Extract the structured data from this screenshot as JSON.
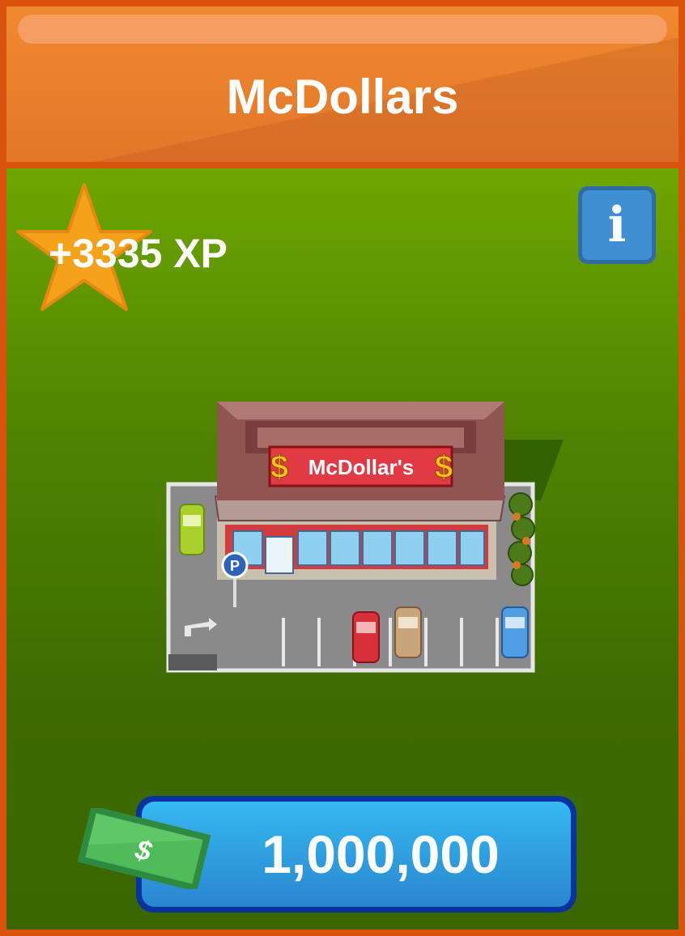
{
  "header": {
    "title": "McDollars"
  },
  "reward": {
    "xp_label": "+3335 XP",
    "icon": "star-icon"
  },
  "info_button": {
    "glyph": "i",
    "icon": "info-icon"
  },
  "building": {
    "sign_text": "McDollar's",
    "icon": "restaurant-building-image"
  },
  "purchase": {
    "price": "1,000,000",
    "cash_symbol": "$",
    "icon": "cash-bill-icon"
  },
  "colors": {
    "header": "#e8802d",
    "border": "#d9530f",
    "body_green": "#4f8302",
    "button_blue": "#3399dd",
    "star": "#f5a21b"
  }
}
